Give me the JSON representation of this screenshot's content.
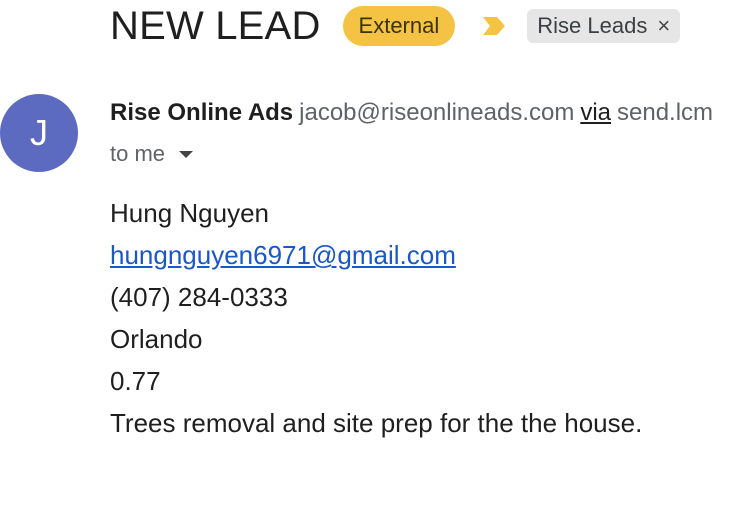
{
  "email": {
    "subject": "NEW LEAD",
    "external_badge": "External",
    "importance_icon": "importance-marker-icon",
    "label_chip": {
      "text": "Rise Leads",
      "remove_symbol": "×"
    },
    "sender": {
      "avatar_letter": "J",
      "avatar_color": "#5c6bc0",
      "name": "Rise Online Ads",
      "email": "jacob@riseonlineads.com",
      "via_label": "via",
      "via_domain": "send.lcm"
    },
    "recipient_text": "to me",
    "body": {
      "name": "Hung Nguyen",
      "email_link": "hungnguyen6971@gmail.com",
      "phone": "(407) 284-0333",
      "city": "Orlando",
      "acreage": "0.77",
      "message": "Trees removal and site prep for the the house."
    }
  },
  "colors": {
    "external_badge_bg": "#f4c343",
    "importance_marker": "#f4c343",
    "link": "#1a57c9"
  }
}
